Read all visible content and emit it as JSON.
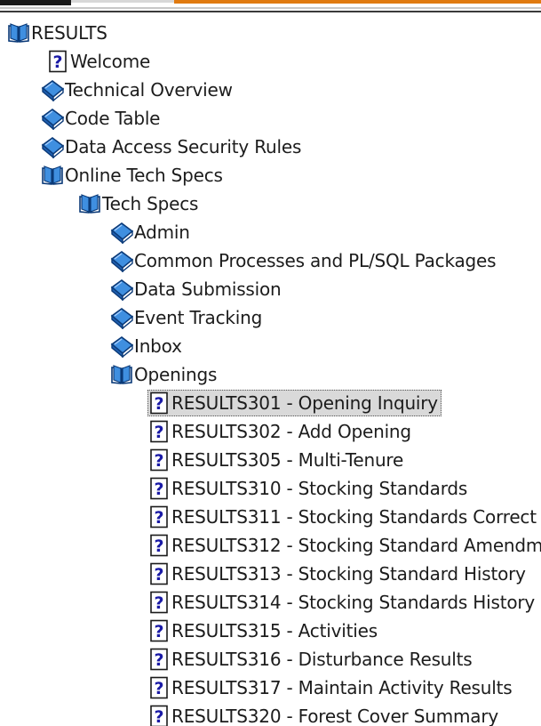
{
  "tree": {
    "nodes": [
      {
        "label": "RESULTS",
        "icon": "open-book-icon",
        "level": 0,
        "selected": false
      },
      {
        "label": "Welcome",
        "icon": "help-page-icon",
        "level": 1,
        "selected": false
      },
      {
        "label": "Technical Overview",
        "icon": "closed-book-icon",
        "level": 1,
        "selected": false
      },
      {
        "label": "Code Table",
        "icon": "closed-book-icon",
        "level": 1,
        "selected": false
      },
      {
        "label": "Data Access Security Rules",
        "icon": "closed-book-icon",
        "level": 1,
        "selected": false
      },
      {
        "label": "Online Tech Specs",
        "icon": "open-book-icon",
        "level": 1,
        "selected": false
      },
      {
        "label": "Tech Specs",
        "icon": "open-book-icon",
        "level": 2,
        "selected": false
      },
      {
        "label": "Admin",
        "icon": "closed-book-icon",
        "level": 3,
        "selected": false
      },
      {
        "label": "Common Processes and PL/SQL Packages",
        "icon": "closed-book-icon",
        "level": 3,
        "selected": false
      },
      {
        "label": "Data Submission",
        "icon": "closed-book-icon",
        "level": 3,
        "selected": false
      },
      {
        "label": "Event Tracking",
        "icon": "closed-book-icon",
        "level": 3,
        "selected": false
      },
      {
        "label": "Inbox",
        "icon": "closed-book-icon",
        "level": 3,
        "selected": false
      },
      {
        "label": "Openings",
        "icon": "open-book-icon",
        "level": 3,
        "selected": false
      },
      {
        "label": "RESULTS301 - Opening Inquiry",
        "icon": "help-page-icon",
        "level": 4,
        "selected": true
      },
      {
        "label": "RESULTS302 - Add Opening",
        "icon": "help-page-icon",
        "level": 4,
        "selected": false
      },
      {
        "label": "RESULTS305 - Multi-Tenure",
        "icon": "help-page-icon",
        "level": 4,
        "selected": false
      },
      {
        "label": "RESULTS310 - Stocking Standards",
        "icon": "help-page-icon",
        "level": 4,
        "selected": false
      },
      {
        "label": "RESULTS311 - Stocking Standards Correct",
        "icon": "help-page-icon",
        "level": 4,
        "selected": false
      },
      {
        "label": "RESULTS312 - Stocking Standard Amendm",
        "icon": "help-page-icon",
        "level": 4,
        "selected": false
      },
      {
        "label": "RESULTS313 - Stocking Standard History",
        "icon": "help-page-icon",
        "level": 4,
        "selected": false
      },
      {
        "label": "RESULTS314 - Stocking Standards History",
        "icon": "help-page-icon",
        "level": 4,
        "selected": false
      },
      {
        "label": "RESULTS315 - Activities",
        "icon": "help-page-icon",
        "level": 4,
        "selected": false
      },
      {
        "label": "RESULTS316 - Disturbance Results",
        "icon": "help-page-icon",
        "level": 4,
        "selected": false
      },
      {
        "label": "RESULTS317 - Maintain Activity Results",
        "icon": "help-page-icon",
        "level": 4,
        "selected": false
      },
      {
        "label": "RESULTS320 - Forest Cover Summary",
        "icon": "help-page-icon",
        "level": 4,
        "selected": false
      }
    ]
  },
  "colors": {
    "book_blue": "#3f8fe0",
    "book_dark": "#0b3a78",
    "help_blue": "#1a1aa6",
    "selection_bg": "#d9d9d9",
    "accent_orange": "#e07a10"
  }
}
